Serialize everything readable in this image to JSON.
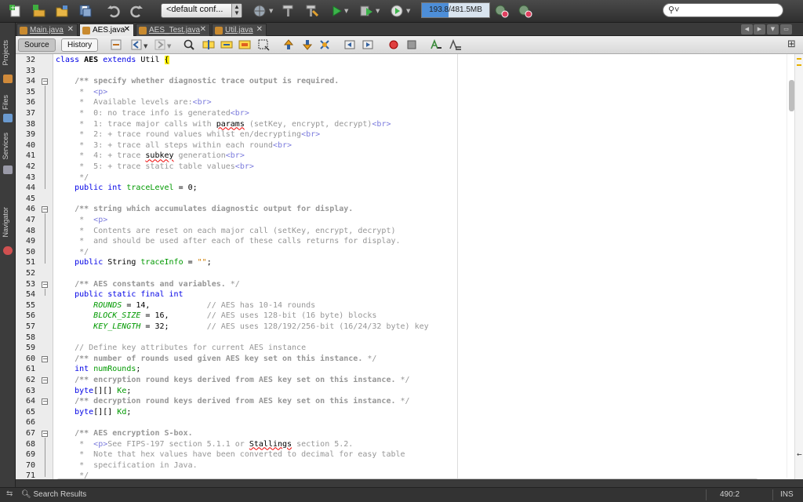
{
  "toolbar": {
    "config_value": "<default conf...",
    "memory_text": "193.8/481.5MB",
    "memory_fraction": 0.4,
    "search_placeholder": ""
  },
  "left_strip": {
    "tabs": [
      "Projects",
      "Files",
      "Services",
      "Navigator"
    ]
  },
  "tabs": [
    {
      "label": "Main.java",
      "active": false
    },
    {
      "label": "AES.java",
      "active": true
    },
    {
      "label": "AES_Test.java",
      "active": false
    },
    {
      "label": "Util.java",
      "active": false
    }
  ],
  "editor_toolbar": {
    "source_label": "Source",
    "history_label": "History"
  },
  "code": {
    "first_line": 32,
    "lines": [
      [
        [
          "kw",
          "class "
        ],
        [
          "kb",
          "AES "
        ],
        [
          "kw",
          "extends "
        ],
        [
          "",
          "Util "
        ],
        [
          "hl",
          "{"
        ]
      ],
      [],
      [
        [
          "",
          "    "
        ],
        [
          "cmb",
          "/** specify whether diagnostic trace output is required."
        ]
      ],
      [
        [
          "",
          "     "
        ],
        [
          "cm",
          "*  "
        ],
        [
          "tag",
          "<p>"
        ]
      ],
      [
        [
          "",
          "     "
        ],
        [
          "cm",
          "*  Available levels are:"
        ],
        [
          "tag",
          "<br>"
        ]
      ],
      [
        [
          "",
          "     "
        ],
        [
          "cm",
          "*  0: no trace info is generated"
        ],
        [
          "tag",
          "<br>"
        ]
      ],
      [
        [
          "",
          "     "
        ],
        [
          "cm",
          "*  1: trace major calls with "
        ],
        [
          "squig",
          "params"
        ],
        [
          "cm",
          " (setKey, encrypt, decrypt)"
        ],
        [
          "tag",
          "<br>"
        ]
      ],
      [
        [
          "",
          "     "
        ],
        [
          "cm",
          "*  2: + trace round values whilst en/decrypting"
        ],
        [
          "tag",
          "<br>"
        ]
      ],
      [
        [
          "",
          "     "
        ],
        [
          "cm",
          "*  3: + trace all steps within each round"
        ],
        [
          "tag",
          "<br>"
        ]
      ],
      [
        [
          "",
          "     "
        ],
        [
          "cm",
          "*  4: + trace "
        ],
        [
          "squig",
          "subkey"
        ],
        [
          "cm",
          " generation"
        ],
        [
          "tag",
          "<br>"
        ]
      ],
      [
        [
          "",
          "     "
        ],
        [
          "cm",
          "*  5: + trace static table values"
        ],
        [
          "tag",
          "<br>"
        ]
      ],
      [
        [
          "",
          "     "
        ],
        [
          "cm",
          "*/"
        ]
      ],
      [
        [
          "",
          "    "
        ],
        [
          "kw",
          "public int "
        ],
        [
          "fld",
          "traceLevel"
        ],
        [
          "",
          " = 0;"
        ]
      ],
      [],
      [
        [
          "",
          "    "
        ],
        [
          "cmb",
          "/** string which accumulates diagnostic output for display."
        ]
      ],
      [
        [
          "",
          "     "
        ],
        [
          "cm",
          "*  "
        ],
        [
          "tag",
          "<p>"
        ]
      ],
      [
        [
          "",
          "     "
        ],
        [
          "cm",
          "*  Contents are reset on each major call (setKey, encrypt, decrypt)"
        ]
      ],
      [
        [
          "",
          "     "
        ],
        [
          "cm",
          "*  and should be used after each of these calls returns for display."
        ]
      ],
      [
        [
          "",
          "     "
        ],
        [
          "cm",
          "*/"
        ]
      ],
      [
        [
          "",
          "    "
        ],
        [
          "kw",
          "public "
        ],
        [
          "",
          "String "
        ],
        [
          "fld",
          "traceInfo"
        ],
        [
          "",
          " = "
        ],
        [
          "str",
          "\"\""
        ],
        [
          "",
          ";"
        ]
      ],
      [],
      [
        [
          "",
          "    "
        ],
        [
          "cmb",
          "/** AES constants and variables. "
        ],
        [
          "cm",
          "*/"
        ]
      ],
      [
        [
          "",
          "    "
        ],
        [
          "kw",
          "public static final int"
        ]
      ],
      [
        [
          "",
          "        "
        ],
        [
          "sfld",
          "ROUNDS"
        ],
        [
          "",
          " = 14,"
        ],
        [
          "",
          "            "
        ],
        [
          "cm",
          "// AES has 10-14 rounds"
        ]
      ],
      [
        [
          "",
          "        "
        ],
        [
          "sfld",
          "BLOCK_SIZE"
        ],
        [
          "",
          " = 16,"
        ],
        [
          "",
          "        "
        ],
        [
          "cm",
          "// AES uses 128-bit (16 byte) blocks"
        ]
      ],
      [
        [
          "",
          "        "
        ],
        [
          "sfld",
          "KEY_LENGTH"
        ],
        [
          "",
          " = 32;"
        ],
        [
          "",
          "        "
        ],
        [
          "cm",
          "// AES uses 128/192/256-bit (16/24/32 byte) key"
        ]
      ],
      [],
      [
        [
          "",
          "    "
        ],
        [
          "cm",
          "// Define key attributes for current AES instance"
        ]
      ],
      [
        [
          "",
          "    "
        ],
        [
          "cmb",
          "/** number of rounds used given AES key set on this instance. "
        ],
        [
          "cm",
          "*/"
        ]
      ],
      [
        [
          "",
          "    "
        ],
        [
          "kw",
          "int "
        ],
        [
          "fld",
          "numRounds"
        ],
        [
          "",
          ";"
        ]
      ],
      [
        [
          "",
          "    "
        ],
        [
          "cmb",
          "/** encryption round keys derived from AES key set on this instance. "
        ],
        [
          "cm",
          "*/"
        ]
      ],
      [
        [
          "",
          "    "
        ],
        [
          "kw",
          "byte"
        ],
        [
          "",
          "[][] "
        ],
        [
          "fld",
          "Ke"
        ],
        [
          "",
          ";"
        ]
      ],
      [
        [
          "",
          "    "
        ],
        [
          "cmb",
          "/** decryption round keys derived from AES key set on this instance. "
        ],
        [
          "cm",
          "*/"
        ]
      ],
      [
        [
          "",
          "    "
        ],
        [
          "kw",
          "byte"
        ],
        [
          "",
          "[][] "
        ],
        [
          "fld",
          "Kd"
        ],
        [
          "",
          ";"
        ]
      ],
      [],
      [
        [
          "",
          "    "
        ],
        [
          "cmb",
          "/** AES encryption S-box."
        ]
      ],
      [
        [
          "",
          "     "
        ],
        [
          "cm",
          "*  "
        ],
        [
          "tag",
          "<p>"
        ],
        [
          "cm",
          "See FIPS-197 section 5.1.1 or "
        ],
        [
          "squig",
          "Stallings"
        ],
        [
          "cm",
          " section 5.2."
        ]
      ],
      [
        [
          "",
          "     "
        ],
        [
          "cm",
          "*  Note that hex values have been converted to decimal for easy table"
        ]
      ],
      [
        [
          "",
          "     "
        ],
        [
          "cm",
          "*  specification in Java."
        ]
      ],
      [
        [
          "",
          "     "
        ],
        [
          "cm",
          "*/"
        ]
      ]
    ],
    "folds": [
      34,
      46,
      53,
      60,
      62,
      64,
      67
    ]
  },
  "status": {
    "search_results": "Search Results",
    "position": "490:2",
    "mode": "INS"
  }
}
